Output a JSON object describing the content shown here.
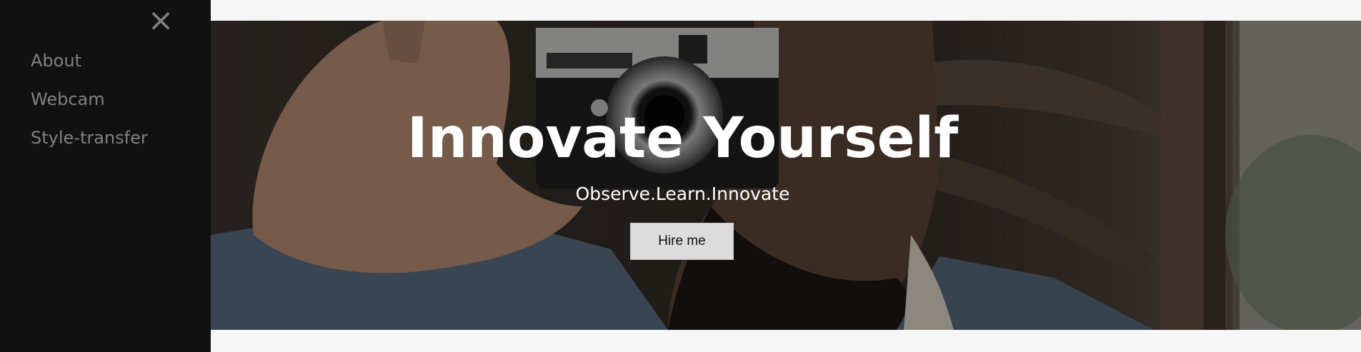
{
  "sidenav": {
    "close_glyph": "×",
    "items": [
      {
        "label": "About"
      },
      {
        "label": "Webcam"
      },
      {
        "label": "Style-transfer"
      }
    ]
  },
  "hero": {
    "title": "Innovate Yourself",
    "subtitle": "Observe.Learn.Innovate",
    "button_label": "Hire me",
    "image_description_icon": "camera-photo"
  },
  "colors": {
    "sidenav_bg": "#111111",
    "nav_text": "#818181",
    "page_bg": "#f6f6f6",
    "button_bg": "#dcdcdc"
  }
}
